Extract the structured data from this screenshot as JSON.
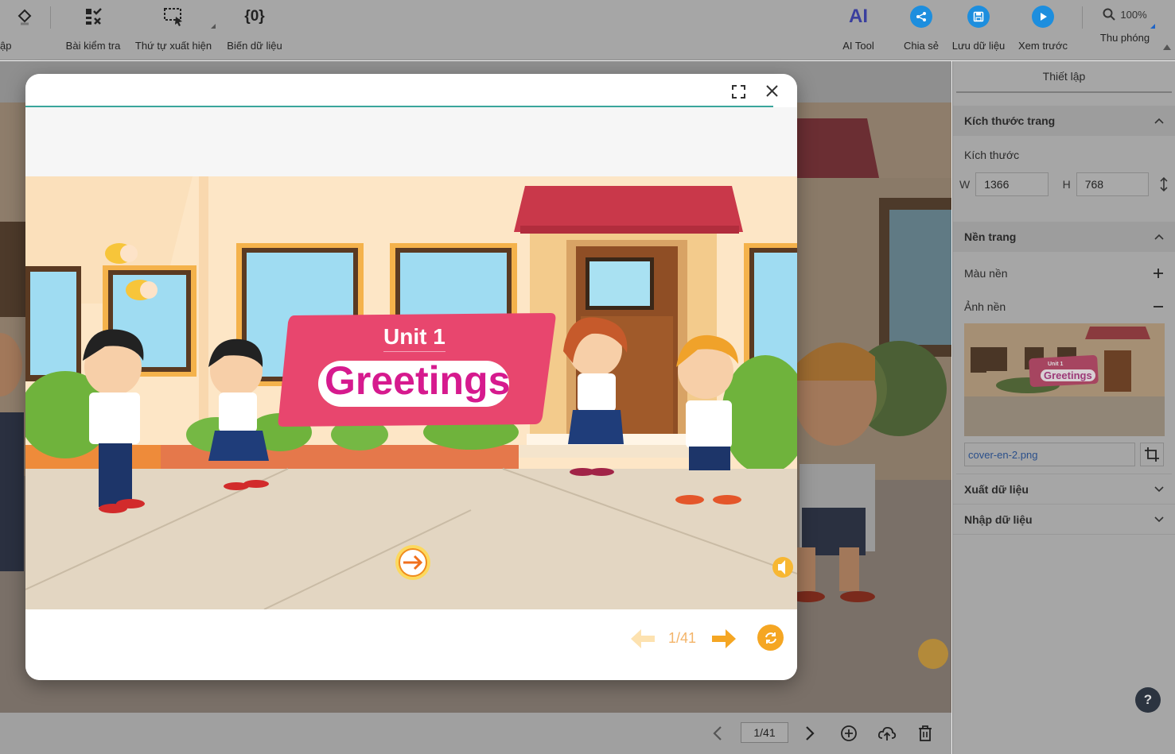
{
  "toolbar": {
    "partial_label": "ập",
    "items": [
      {
        "label": "Bài kiểm tra",
        "icon": "quiz-icon"
      },
      {
        "label": "Thứ tự xuất hiện",
        "icon": "selection-order-icon"
      },
      {
        "label": "Biến dữ liệu",
        "icon": "data-variable-icon"
      }
    ],
    "var_glyph": "{0}",
    "ai_tool": {
      "label": "AI Tool",
      "glyph": "AI"
    },
    "share": {
      "label": "Chia sẻ"
    },
    "save": {
      "label": "Lưu dữ liệu"
    },
    "preview": {
      "label": "Xem trước"
    },
    "zoom": {
      "label": "Thu phóng",
      "value": "100%"
    }
  },
  "modal": {
    "slide_title_small": "Unit 1",
    "slide_title_big": "Greetings",
    "page_indicator": "1/41"
  },
  "bottom_bar": {
    "page_indicator": "1/41"
  },
  "right_panel": {
    "tab": "Thiết lập",
    "page_size": {
      "title": "Kích thước trang",
      "size_label": "Kích thước",
      "w_label": "W",
      "w_value": "1366",
      "h_label": "H",
      "h_value": "768"
    },
    "background": {
      "title": "Nền trang",
      "color_label": "Màu nền",
      "image_label": "Ảnh nền",
      "file_name": "cover-en-2.png",
      "thumb_small": "Unit 1",
      "thumb_big": "Greetings"
    },
    "export_label": "Xuất dữ liệu",
    "import_label": "Nhập dữ liệu"
  },
  "help": "?",
  "colors": {
    "accent_blue": "#1d8ede",
    "banner_pink": "#e8466e",
    "title_magenta": "#d61a8e",
    "arrow_orange": "#f5a623",
    "progress_teal": "#3aa59b"
  }
}
